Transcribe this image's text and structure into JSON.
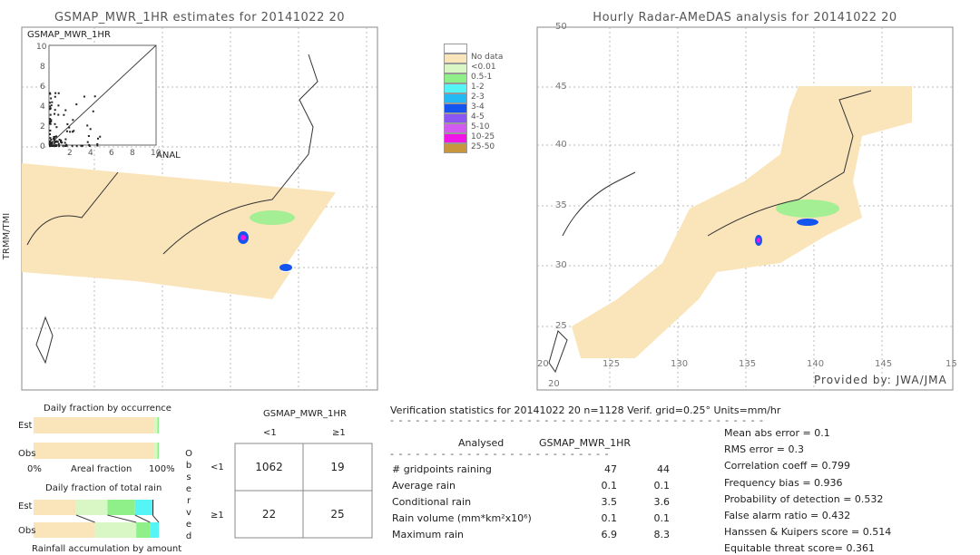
{
  "left_map": {
    "title": "GSMAP_MWR_1HR estimates for 20141022 20",
    "side_label": "TRMM/TMI",
    "inset": {
      "title": "GSMAP_MWR_1HR",
      "xlabel": "ANAL",
      "y_ticks": [
        "10",
        "8",
        "6",
        "4",
        "2",
        "0"
      ],
      "x_ticks": [
        "2",
        "4",
        "6",
        "8",
        "10"
      ]
    }
  },
  "right_map": {
    "title": "Hourly Radar-AMeDAS analysis for 20141022 20",
    "credit": "Provided by: JWA/JMA",
    "lat_ticks": [
      "45",
      "40",
      "35",
      "30",
      "25",
      "20"
    ],
    "lon_ticks": [
      "20",
      "125",
      "130",
      "135",
      "140",
      "145",
      "15"
    ],
    "top_tick": "50"
  },
  "legend": {
    "items": [
      {
        "label": "",
        "color": "#ffffff"
      },
      {
        "label": "No data",
        "color": "#fae5bb"
      },
      {
        "label": "<0.01",
        "color": "#d9f7c4"
      },
      {
        "label": "0.5-1",
        "color": "#8ff08a"
      },
      {
        "label": "1-2",
        "color": "#55f5f5"
      },
      {
        "label": "2-3",
        "color": "#22b9f5"
      },
      {
        "label": "3-4",
        "color": "#1455f0"
      },
      {
        "label": "4-5",
        "color": "#8a55f0"
      },
      {
        "label": "5-10",
        "color": "#d25af0"
      },
      {
        "label": "10-25",
        "color": "#f014e6"
      },
      {
        "label": "25-50",
        "color": "#c8963c"
      }
    ]
  },
  "occurrence": {
    "title": "Daily fraction by occurrence",
    "est_label": "Est",
    "obs_label": "Obs",
    "x_min": "0%",
    "x_mid": "Areal fraction",
    "x_max": "100%",
    "est_rain_fraction": 0.04,
    "obs_rain_fraction": 0.04
  },
  "total_rain": {
    "title": "Daily fraction of total rain",
    "est_label": "Est",
    "obs_label": "Obs",
    "footer": "Rainfall accumulation by amount",
    "est_fractions": [
      0.34,
      0.25,
      0.22,
      0.14
    ],
    "obs_fractions": [
      0.49,
      0.33,
      0.11,
      0.07
    ]
  },
  "contingency": {
    "title": "GSMAP_MWR_1HR",
    "col_labels": [
      "<1",
      "≥1"
    ],
    "row_labels": [
      "<1",
      "≥1"
    ],
    "side_label": "Observed",
    "cells": [
      [
        "1062",
        "19"
      ],
      [
        "22",
        "25"
      ]
    ]
  },
  "stats": {
    "header": "Verification statistics for 20141022 20  n=1128  Verif. grid=0.25°  Units=mm/hr",
    "col_analysed": "Analysed",
    "col_est": "GSMAP_MWR_1HR",
    "rows": [
      {
        "label": "# gridpoints raining",
        "a": "47",
        "e": "44"
      },
      {
        "label": "Average rain",
        "a": "0.1",
        "e": "0.1"
      },
      {
        "label": "Conditional rain",
        "a": "3.5",
        "e": "3.6"
      },
      {
        "label": "Rain volume (mm*km²x10⁶)",
        "a": "0.1",
        "e": "0.1"
      },
      {
        "label": "Maximum rain",
        "a": "6.9",
        "e": "8.3"
      }
    ],
    "scores": [
      "Mean abs error = 0.1",
      "RMS error = 0.3",
      "Correlation coeff = 0.799",
      "Frequency bias = 0.936",
      "Probability of detection = 0.532",
      "False alarm ratio = 0.432",
      "Hanssen & Kuipers score = 0.514",
      "Equitable threat score= 0.361"
    ]
  }
}
